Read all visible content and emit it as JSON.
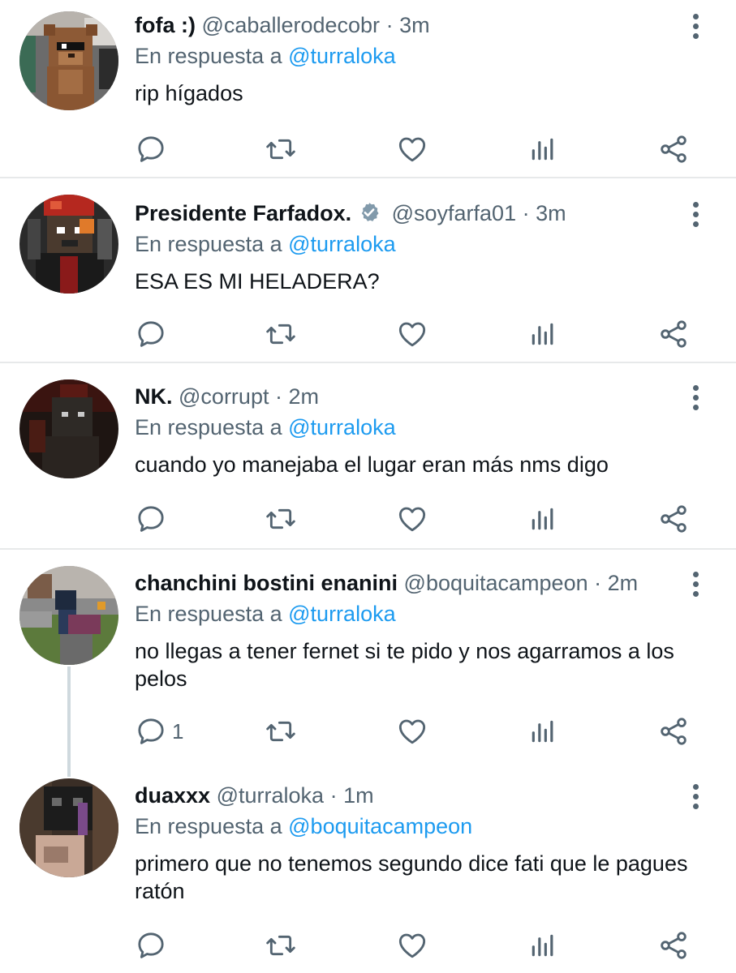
{
  "colors": {
    "link": "#1d9bf0",
    "muted": "#536471",
    "text": "#0f1419",
    "divider": "#e7e9ea"
  },
  "tweets": [
    {
      "name": "fofa :)",
      "handle": "@caballerodecobr",
      "time": "3m",
      "reply_prefix": "En respuesta a",
      "reply_to": "@turraloka",
      "text": "rip hígados",
      "verified": false,
      "reply_count": ""
    },
    {
      "name": "Presidente Farfadox.",
      "handle": "@soyfarfa01",
      "time": "3m",
      "reply_prefix": "En respuesta a",
      "reply_to": "@turraloka",
      "text": "ESA ES MI HELADERA?",
      "verified": true,
      "reply_count": ""
    },
    {
      "name": "NK.",
      "handle": "@corrupt",
      "time": "2m",
      "reply_prefix": "En respuesta a",
      "reply_to": "@turraloka",
      "text": "cuando yo manejaba el lugar eran más nms digo",
      "verified": false,
      "reply_count": ""
    },
    {
      "name": "chanchini bostini enanini",
      "handle": "@boquitacampeon",
      "time": "2m",
      "reply_prefix": "En respuesta a",
      "reply_to": "@turraloka",
      "text": "no llegas a tener fernet si te pido y nos agarramos a los pelos",
      "verified": false,
      "reply_count": "1"
    },
    {
      "name": "duaxxx",
      "handle": "@turraloka",
      "time": "1m",
      "reply_prefix": "En respuesta a",
      "reply_to": "@boquitacampeon",
      "text": "primero que no tenemos segundo dice fati que le pagues ratón",
      "verified": false,
      "reply_count": ""
    }
  ],
  "icons": {
    "reply": "reply-icon",
    "retweet": "retweet-icon",
    "like": "like-icon",
    "views": "analytics-icon",
    "share": "share-icon",
    "more": "more-icon",
    "verified": "verified-badge-icon"
  }
}
